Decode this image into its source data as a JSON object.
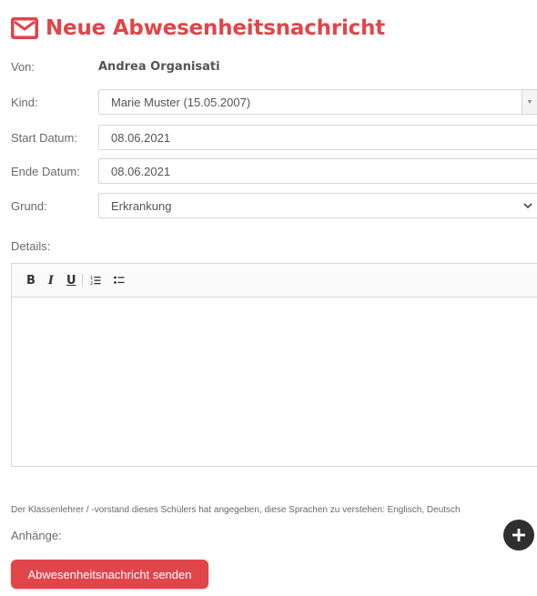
{
  "page": {
    "title": "Neue Abwesenheitsnachricht",
    "accent_color": "#e0454a",
    "title_icon": "envelope-icon"
  },
  "form": {
    "from_label": "Von:",
    "from_value": "Andrea Organisati",
    "child_label": "Kind:",
    "child_value": "Marie Muster (15.05.2007)",
    "start_label": "Start Datum:",
    "start_value": "08.06.2021",
    "end_label": "Ende Datum:",
    "end_value": "08.06.2021",
    "reason_label": "Grund:",
    "reason_value": "Erkrankung",
    "details_label": "Details:"
  },
  "editor": {
    "bold_label": "B",
    "italic_label": "I",
    "underline_label": "U",
    "icons": [
      "ordered-list-icon",
      "bullet-list-icon"
    ]
  },
  "footer": {
    "language_note": "Der Klassenlehrer / -vorstand dieses Schülers hat angegeben, diese Sprachen zu verstehen: Englisch, Deutsch",
    "attachments_label": "Anhänge:",
    "add_icon": "plus-icon",
    "send_label": "Abwesenheitsnachricht senden"
  }
}
